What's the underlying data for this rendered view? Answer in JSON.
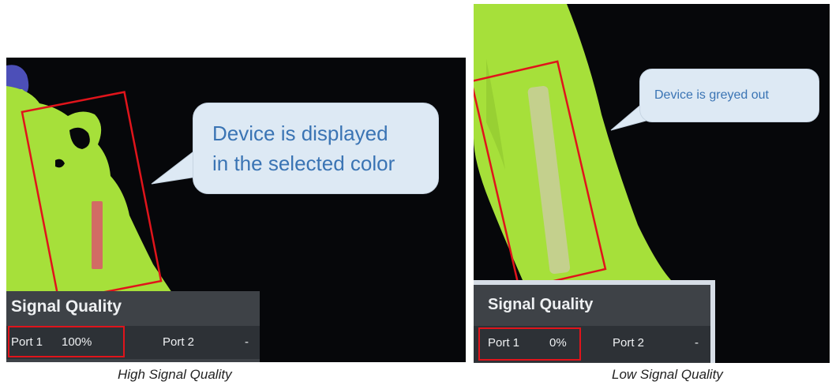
{
  "left": {
    "callout_line1": "Device is displayed",
    "callout_line2": "in the selected color",
    "signal_quality_title": "Signal Quality",
    "port1_label": "Port 1",
    "port1_value": "100%",
    "port2_label": "Port 2",
    "port2_value": "-",
    "caption": "High Signal Quality"
  },
  "right": {
    "callout": "Device is greyed out",
    "signal_quality_title": "Signal Quality",
    "port1_label": "Port 1",
    "port1_value": "0%",
    "port2_label": "Port 2",
    "port2_value": "-",
    "caption": "Low Signal Quality"
  },
  "colors": {
    "anatomy": "#a6e03a",
    "background": "#06070a",
    "highlight": "#e0141b",
    "callout_text": "#3a74b4",
    "device_active": "#d26c64",
    "device_greyed": "#c9cc9c"
  }
}
